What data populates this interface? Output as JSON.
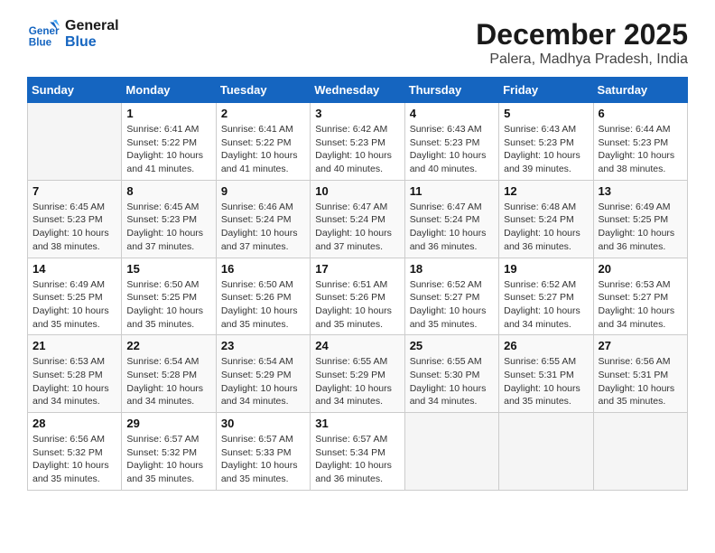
{
  "logo": {
    "line1": "General",
    "line2": "Blue"
  },
  "title": "December 2025",
  "subtitle": "Palera, Madhya Pradesh, India",
  "weekdays": [
    "Sunday",
    "Monday",
    "Tuesday",
    "Wednesday",
    "Thursday",
    "Friday",
    "Saturday"
  ],
  "weeks": [
    [
      {
        "day": "",
        "info": ""
      },
      {
        "day": "1",
        "info": "Sunrise: 6:41 AM\nSunset: 5:22 PM\nDaylight: 10 hours\nand 41 minutes."
      },
      {
        "day": "2",
        "info": "Sunrise: 6:41 AM\nSunset: 5:22 PM\nDaylight: 10 hours\nand 41 minutes."
      },
      {
        "day": "3",
        "info": "Sunrise: 6:42 AM\nSunset: 5:23 PM\nDaylight: 10 hours\nand 40 minutes."
      },
      {
        "day": "4",
        "info": "Sunrise: 6:43 AM\nSunset: 5:23 PM\nDaylight: 10 hours\nand 40 minutes."
      },
      {
        "day": "5",
        "info": "Sunrise: 6:43 AM\nSunset: 5:23 PM\nDaylight: 10 hours\nand 39 minutes."
      },
      {
        "day": "6",
        "info": "Sunrise: 6:44 AM\nSunset: 5:23 PM\nDaylight: 10 hours\nand 38 minutes."
      }
    ],
    [
      {
        "day": "7",
        "info": "Sunrise: 6:45 AM\nSunset: 5:23 PM\nDaylight: 10 hours\nand 38 minutes."
      },
      {
        "day": "8",
        "info": "Sunrise: 6:45 AM\nSunset: 5:23 PM\nDaylight: 10 hours\nand 37 minutes."
      },
      {
        "day": "9",
        "info": "Sunrise: 6:46 AM\nSunset: 5:24 PM\nDaylight: 10 hours\nand 37 minutes."
      },
      {
        "day": "10",
        "info": "Sunrise: 6:47 AM\nSunset: 5:24 PM\nDaylight: 10 hours\nand 37 minutes."
      },
      {
        "day": "11",
        "info": "Sunrise: 6:47 AM\nSunset: 5:24 PM\nDaylight: 10 hours\nand 36 minutes."
      },
      {
        "day": "12",
        "info": "Sunrise: 6:48 AM\nSunset: 5:24 PM\nDaylight: 10 hours\nand 36 minutes."
      },
      {
        "day": "13",
        "info": "Sunrise: 6:49 AM\nSunset: 5:25 PM\nDaylight: 10 hours\nand 36 minutes."
      }
    ],
    [
      {
        "day": "14",
        "info": "Sunrise: 6:49 AM\nSunset: 5:25 PM\nDaylight: 10 hours\nand 35 minutes."
      },
      {
        "day": "15",
        "info": "Sunrise: 6:50 AM\nSunset: 5:25 PM\nDaylight: 10 hours\nand 35 minutes."
      },
      {
        "day": "16",
        "info": "Sunrise: 6:50 AM\nSunset: 5:26 PM\nDaylight: 10 hours\nand 35 minutes."
      },
      {
        "day": "17",
        "info": "Sunrise: 6:51 AM\nSunset: 5:26 PM\nDaylight: 10 hours\nand 35 minutes."
      },
      {
        "day": "18",
        "info": "Sunrise: 6:52 AM\nSunset: 5:27 PM\nDaylight: 10 hours\nand 35 minutes."
      },
      {
        "day": "19",
        "info": "Sunrise: 6:52 AM\nSunset: 5:27 PM\nDaylight: 10 hours\nand 34 minutes."
      },
      {
        "day": "20",
        "info": "Sunrise: 6:53 AM\nSunset: 5:27 PM\nDaylight: 10 hours\nand 34 minutes."
      }
    ],
    [
      {
        "day": "21",
        "info": "Sunrise: 6:53 AM\nSunset: 5:28 PM\nDaylight: 10 hours\nand 34 minutes."
      },
      {
        "day": "22",
        "info": "Sunrise: 6:54 AM\nSunset: 5:28 PM\nDaylight: 10 hours\nand 34 minutes."
      },
      {
        "day": "23",
        "info": "Sunrise: 6:54 AM\nSunset: 5:29 PM\nDaylight: 10 hours\nand 34 minutes."
      },
      {
        "day": "24",
        "info": "Sunrise: 6:55 AM\nSunset: 5:29 PM\nDaylight: 10 hours\nand 34 minutes."
      },
      {
        "day": "25",
        "info": "Sunrise: 6:55 AM\nSunset: 5:30 PM\nDaylight: 10 hours\nand 34 minutes."
      },
      {
        "day": "26",
        "info": "Sunrise: 6:55 AM\nSunset: 5:31 PM\nDaylight: 10 hours\nand 35 minutes."
      },
      {
        "day": "27",
        "info": "Sunrise: 6:56 AM\nSunset: 5:31 PM\nDaylight: 10 hours\nand 35 minutes."
      }
    ],
    [
      {
        "day": "28",
        "info": "Sunrise: 6:56 AM\nSunset: 5:32 PM\nDaylight: 10 hours\nand 35 minutes."
      },
      {
        "day": "29",
        "info": "Sunrise: 6:57 AM\nSunset: 5:32 PM\nDaylight: 10 hours\nand 35 minutes."
      },
      {
        "day": "30",
        "info": "Sunrise: 6:57 AM\nSunset: 5:33 PM\nDaylight: 10 hours\nand 35 minutes."
      },
      {
        "day": "31",
        "info": "Sunrise: 6:57 AM\nSunset: 5:34 PM\nDaylight: 10 hours\nand 36 minutes."
      },
      {
        "day": "",
        "info": ""
      },
      {
        "day": "",
        "info": ""
      },
      {
        "day": "",
        "info": ""
      }
    ]
  ]
}
